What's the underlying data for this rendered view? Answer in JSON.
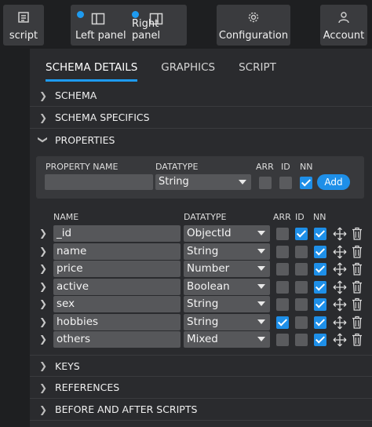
{
  "toolbar": {
    "script": "script",
    "left_panel": "Left panel",
    "right_panel": "Right panel",
    "configuration": "Configuration",
    "account": "Account"
  },
  "tabs": [
    "SCHEMA DETAILS",
    "GRAPHICS",
    "SCRIPT"
  ],
  "sections_top": [
    "SCHEMA",
    "SCHEMA SPECIFICS",
    "PROPERTIES"
  ],
  "new_property": {
    "name_label": "PROPERTY NAME",
    "datatype_label": "DATATYPE",
    "arr_label": "ARR",
    "id_label": "ID",
    "nn_label": "NN",
    "name_value": "",
    "datatype_value": "String",
    "add_label": "Add"
  },
  "table": {
    "headers": {
      "name": "NAME",
      "datatype": "DATATYPE",
      "arr": "ARR",
      "id": "ID",
      "nn": "NN"
    },
    "rows": [
      {
        "name": "_id",
        "datatype": "ObjectId",
        "arr": false,
        "id": true,
        "nn": true
      },
      {
        "name": "name",
        "datatype": "String",
        "arr": false,
        "id": false,
        "nn": true
      },
      {
        "name": "price",
        "datatype": "Number",
        "arr": false,
        "id": false,
        "nn": true
      },
      {
        "name": "active",
        "datatype": "Boolean",
        "arr": false,
        "id": false,
        "nn": true
      },
      {
        "name": "sex",
        "datatype": "String",
        "arr": false,
        "id": false,
        "nn": true
      },
      {
        "name": "hobbies",
        "datatype": "String",
        "arr": true,
        "id": false,
        "nn": true
      },
      {
        "name": "others",
        "datatype": "Mixed",
        "arr": false,
        "id": false,
        "nn": true
      }
    ]
  },
  "sections_bottom": [
    "KEYS",
    "REFERENCES",
    "BEFORE AND AFTER SCRIPTS"
  ],
  "colors": {
    "accent": "#1e8fe8",
    "background": "#2a2b2e",
    "field": "#56575a"
  }
}
